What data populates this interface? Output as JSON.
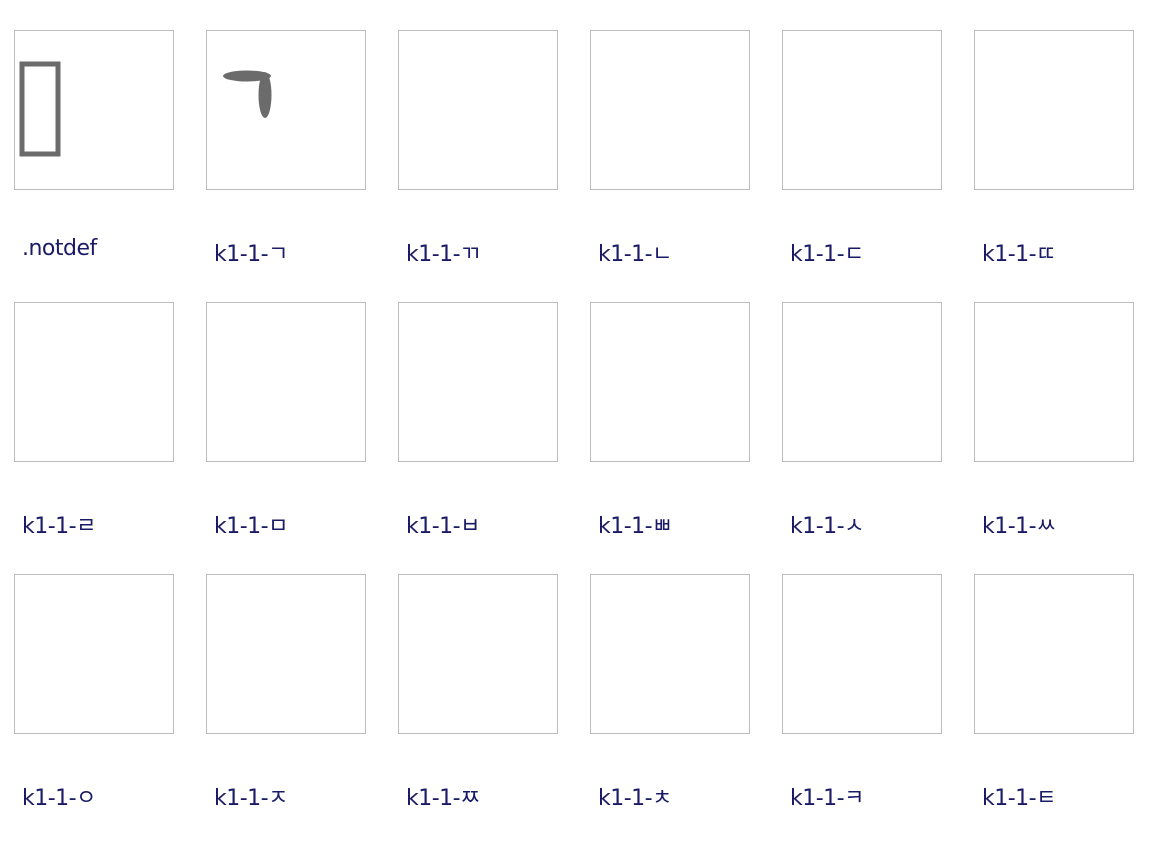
{
  "colors": {
    "glyph_fill": "#6b6b6b",
    "label_text": "#1a1a66",
    "box_border": "#bdbdbd"
  },
  "glyphs": [
    {
      "label": ".notdef",
      "icon": "notdef-rectangle-icon"
    },
    {
      "label": "k1-1-ㄱ",
      "icon": "giyeok-stroke-icon"
    },
    {
      "label": "k1-1-ㄲ",
      "icon": ""
    },
    {
      "label": "k1-1-ㄴ",
      "icon": ""
    },
    {
      "label": "k1-1-ㄷ",
      "icon": ""
    },
    {
      "label": "k1-1-ㄸ",
      "icon": ""
    },
    {
      "label": "k1-1-ㄹ",
      "icon": ""
    },
    {
      "label": "k1-1-ㅁ",
      "icon": ""
    },
    {
      "label": "k1-1-ㅂ",
      "icon": ""
    },
    {
      "label": "k1-1-ㅃ",
      "icon": ""
    },
    {
      "label": "k1-1-ㅅ",
      "icon": ""
    },
    {
      "label": "k1-1-ㅆ",
      "icon": ""
    },
    {
      "label": "k1-1-ㅇ",
      "icon": ""
    },
    {
      "label": "k1-1-ㅈ",
      "icon": ""
    },
    {
      "label": "k1-1-ㅉ",
      "icon": ""
    },
    {
      "label": "k1-1-ㅊ",
      "icon": ""
    },
    {
      "label": "k1-1-ㅋ",
      "icon": ""
    },
    {
      "label": "k1-1-ㅌ",
      "icon": ""
    }
  ]
}
